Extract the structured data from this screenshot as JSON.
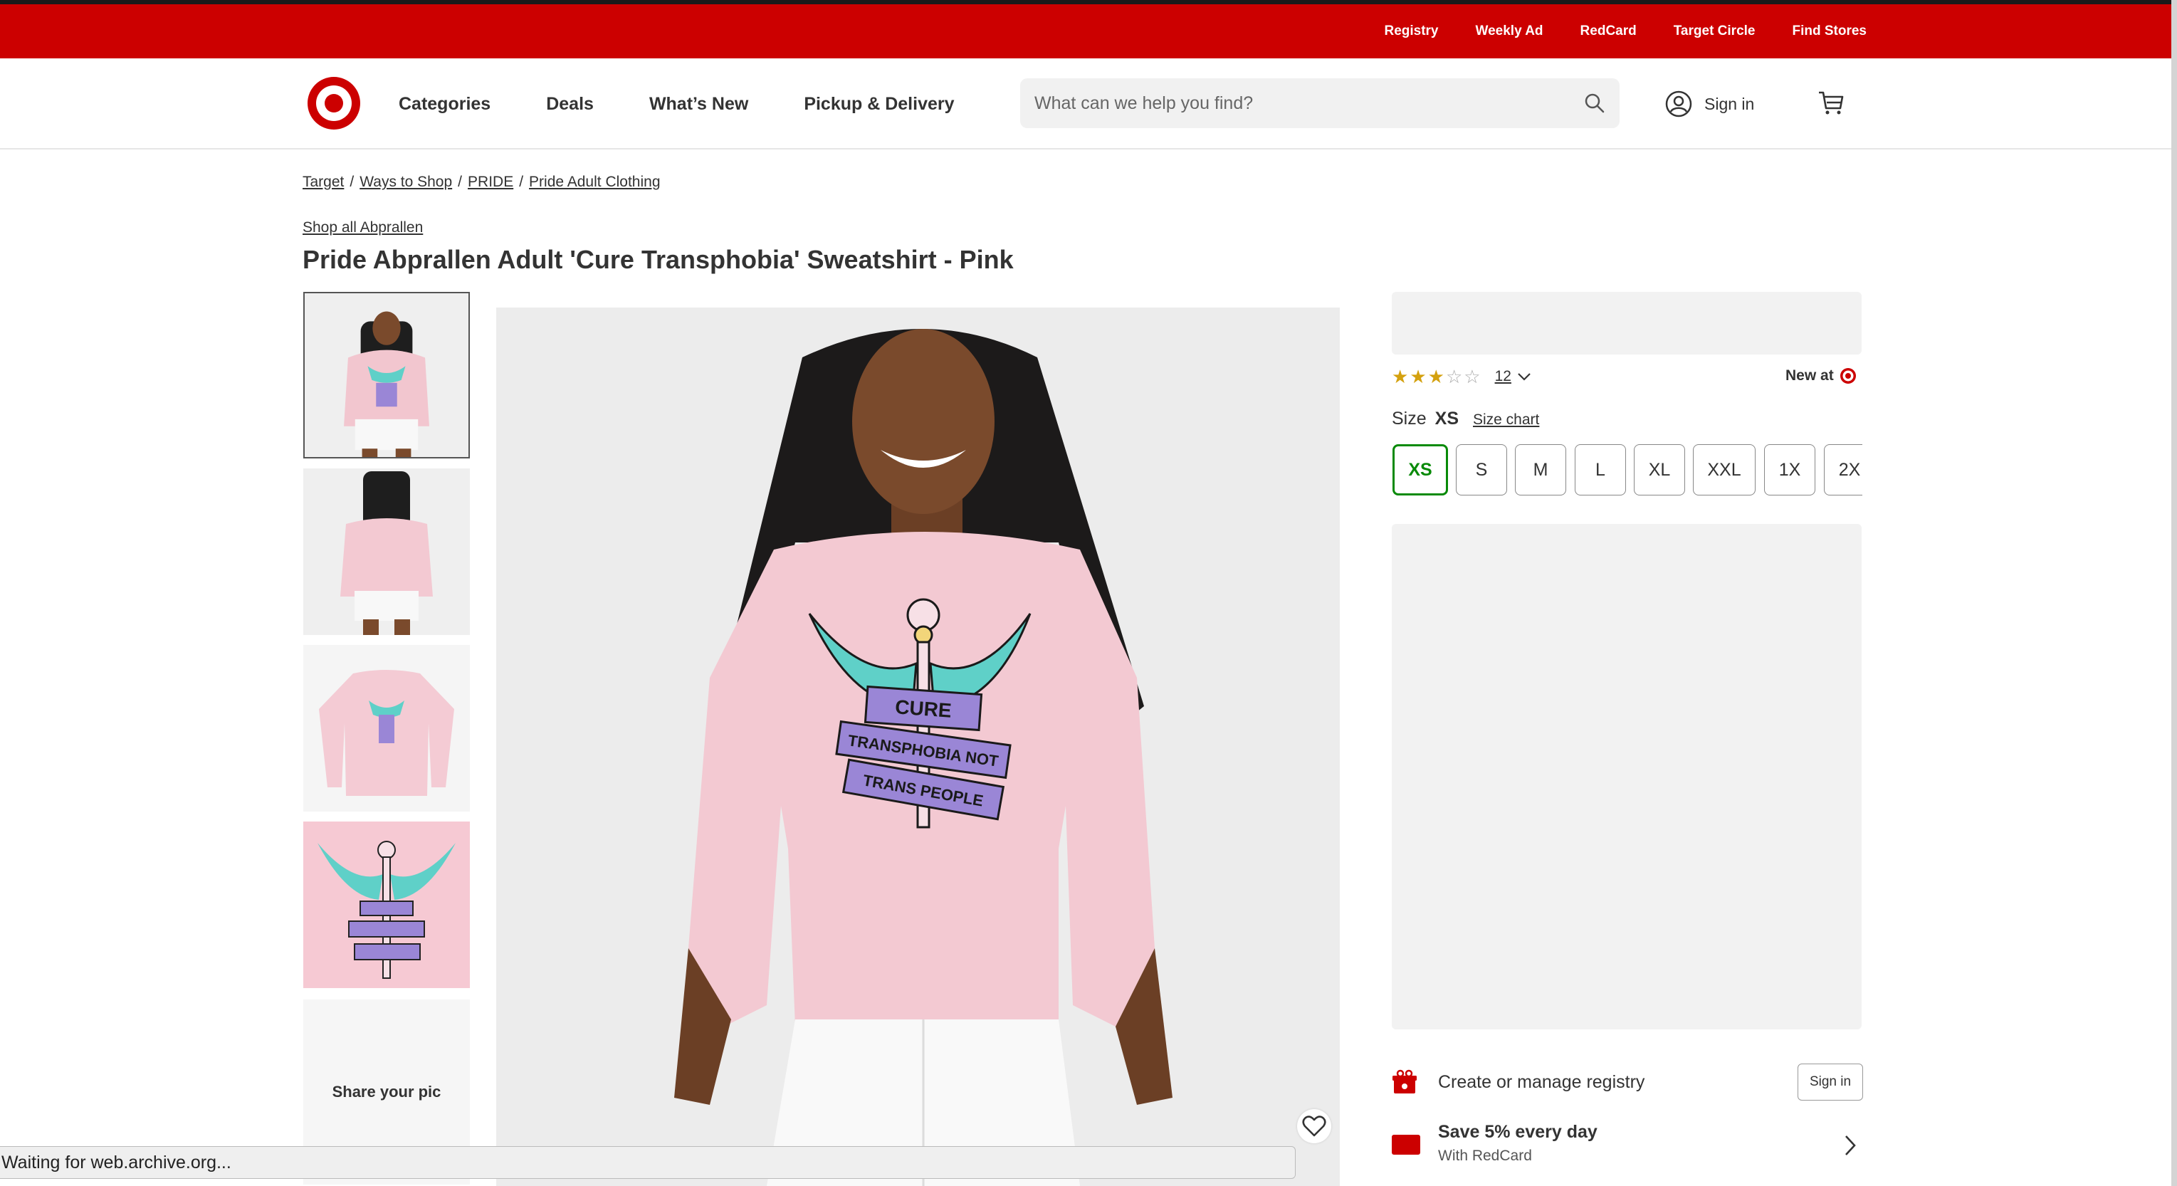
{
  "utility_links": [
    "Registry",
    "Weekly Ad",
    "RedCard",
    "Target Circle",
    "Find Stores"
  ],
  "colors": {
    "brand_red": "#cc0000",
    "selected_green": "#088a08",
    "star_gold": "#d4a10f"
  },
  "header": {
    "logo_icon": "target-bullseye-icon",
    "nav": [
      "Categories",
      "Deals",
      "What’s New",
      "Pickup & Delivery"
    ],
    "search_placeholder": "What can we help you find?",
    "signin_label": "Sign in"
  },
  "breadcrumb": [
    "Target",
    "Ways to Shop",
    "PRIDE",
    "Pride Adult Clothing"
  ],
  "product": {
    "shop_all": "Shop all Abprallen",
    "title": "Pride Abprallen Adult 'Cure Transphobia' Sweatshirt - Pink",
    "rating": 3,
    "rating_max": 5,
    "review_count": "12",
    "new_at": "New at",
    "size_label": "Size",
    "selected_size": "XS",
    "size_chart": "Size chart",
    "sizes": [
      "XS",
      "S",
      "M",
      "L",
      "XL",
      "XXL",
      "1X",
      "2X"
    ],
    "share_pic": "Share your pic",
    "shirt_text": [
      "CURE",
      "TRANSPHOBIA NOT",
      "TRANS PEOPLE"
    ]
  },
  "fulfillment": {
    "registry_text": "Create or manage registry",
    "registry_signin": "Sign in",
    "redcard_title": "Save 5% every day",
    "redcard_sub": "With RedCard"
  },
  "status": "Waiting for web.archive.org..."
}
